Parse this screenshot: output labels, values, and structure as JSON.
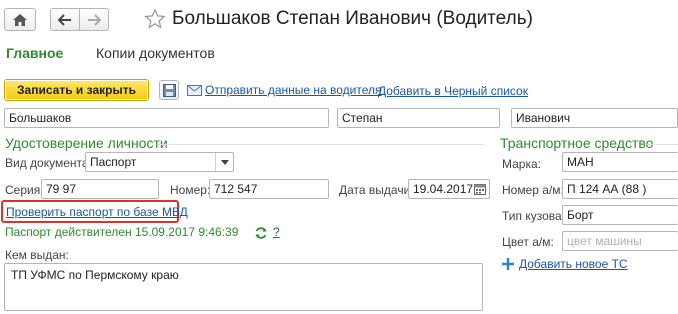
{
  "header": {
    "title": "Большаков Степан Иванович (Водитель)"
  },
  "tabs": [
    {
      "label": "Главное"
    },
    {
      "label": "Копии документов"
    }
  ],
  "toolbar": {
    "save_close_label": "Записать и закрыть",
    "send_driver_link": "Отправить данные на водителя",
    "blacklist_link": "Добавить в Черный список"
  },
  "name": {
    "last": "Большаков",
    "first": "Степан",
    "middle": "Иванович"
  },
  "identity": {
    "section_title": "Удостоверение личности",
    "doc_type_label": "Вид документа:",
    "doc_type_value": "Паспорт",
    "series_label": "Серия:",
    "series_value": "79 97",
    "number_label": "Номер:",
    "number_value": "712 547",
    "issue_date_label": "Дата выдачи:",
    "issue_date_value": "19.04.2017",
    "check_link": "Проверить паспорт по базе МВД",
    "status_text": "Паспорт действителен 15.09.2017 9:46:39",
    "help_label": "?",
    "issued_by_label": "Кем выдан:",
    "issued_by_value": "ТП УФМС по Пермскому краю"
  },
  "vehicle": {
    "section_title": "Транспортное средство",
    "brand_label": "Марка:",
    "brand_value": "МАН",
    "plate_label": "Номер а/м:",
    "plate_value": "П 124 АА (88 )",
    "body_label": "Тип кузова:",
    "body_value": "Борт",
    "color_label": "Цвет а/м:",
    "color_placeholder": "цвет машины",
    "add_link": "Добавить новое ТС"
  },
  "colors": {
    "accent_green": "#2e8b2e",
    "link_blue": "#1a55a6",
    "save_yellow": "#f6c812",
    "highlight_red": "#d9342b"
  },
  "icons": [
    "home-icon",
    "back-arrow-icon",
    "forward-arrow-icon",
    "star-icon",
    "disk-icon",
    "envelope-icon",
    "refresh-icon",
    "calendar-icon",
    "plus-icon",
    "chevron-down-icon"
  ]
}
